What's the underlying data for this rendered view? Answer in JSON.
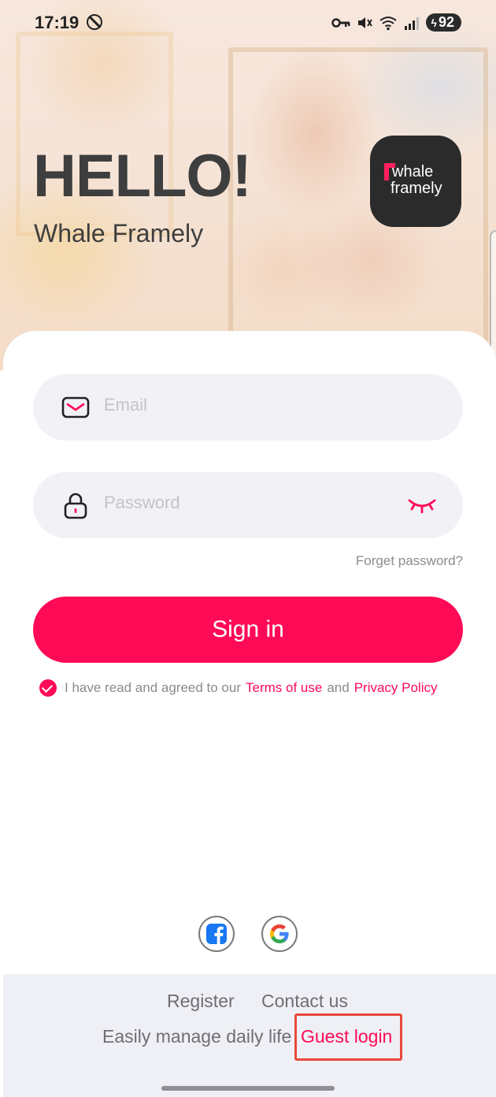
{
  "status_bar": {
    "time": "17:19",
    "battery": "92",
    "icons": [
      "dnd-icon",
      "key-icon",
      "mute-icon",
      "wifi-icon",
      "signal-icon",
      "battery-charging-icon"
    ]
  },
  "hero": {
    "title": "HELLO!",
    "app_name": "Whale Framely",
    "logo_line1": "whale",
    "logo_line2": "framely"
  },
  "form": {
    "email_placeholder": "Email",
    "password_placeholder": "Password",
    "forget_password": "Forget password?",
    "signin_label": "Sign in"
  },
  "agreement": {
    "prefix": "I have read and agreed to our",
    "terms": "Terms of use",
    "and": "and",
    "privacy": "Privacy Policy",
    "checked": true
  },
  "social": [
    "facebook-icon",
    "google-icon"
  ],
  "footer": {
    "register": "Register",
    "contact": "Contact us",
    "tagline": "Easily manage daily life",
    "guest_login": "Guest login"
  },
  "colors": {
    "accent": "#ff0a56",
    "highlight_box": "#e8483a",
    "logo_bg": "#2b2b2b"
  }
}
